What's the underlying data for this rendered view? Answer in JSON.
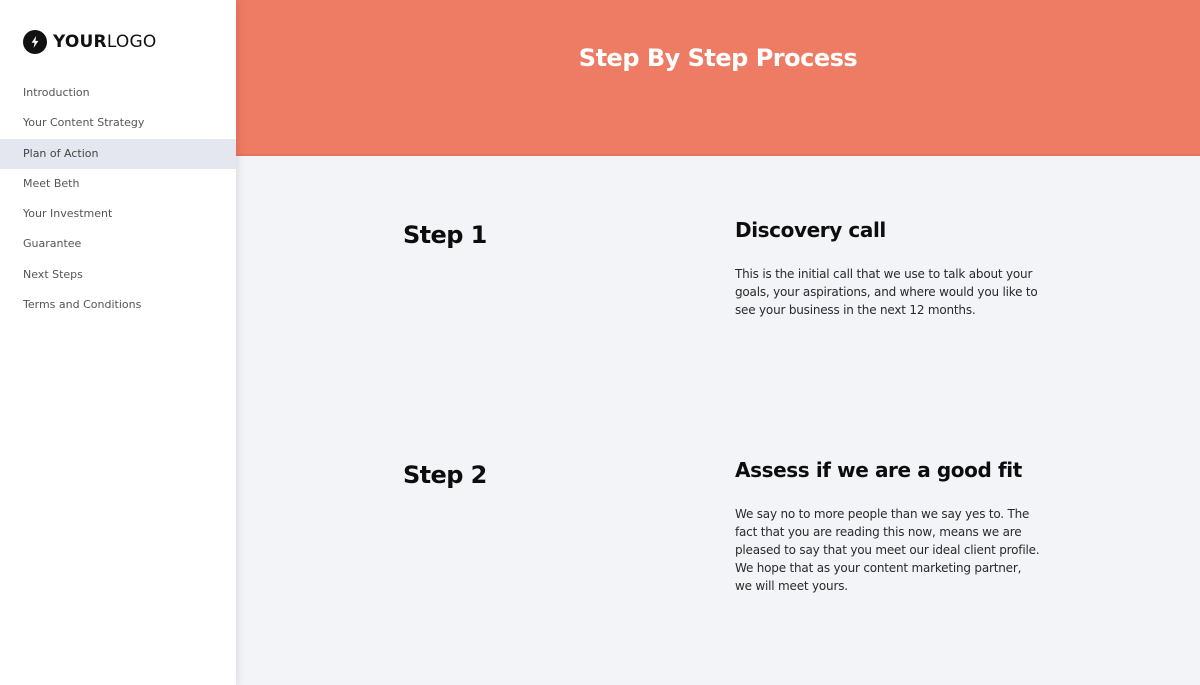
{
  "brand": {
    "logo_bold": "YOUR",
    "logo_light": "LOGO",
    "logo_icon": "lightning-bolt-icon"
  },
  "sidebar": {
    "active_index": 2,
    "items": [
      {
        "label": "Introduction"
      },
      {
        "label": "Your Content Strategy"
      },
      {
        "label": "Plan of Action"
      },
      {
        "label": "Meet Beth"
      },
      {
        "label": "Your Investment"
      },
      {
        "label": "Guarantee"
      },
      {
        "label": "Next Steps"
      },
      {
        "label": "Terms and Conditions"
      }
    ]
  },
  "banner": {
    "title": "Step By Step Process",
    "color": "#ee7b64"
  },
  "steps": [
    {
      "label": "Step 1",
      "heading": "Discovery call",
      "body": "This is the initial call that we use to talk about your goals, your aspirations, and where would you like to see your business in the next 12 months."
    },
    {
      "label": "Step 2",
      "heading": "Assess if we are a good fit",
      "body": "We say no to more people than we say yes to. The fact that you are reading this now, means we are pleased to say that you meet our ideal client profile. We hope that as your content marketing partner, we will meet yours."
    }
  ],
  "colors": {
    "accent": "#ee7b64",
    "content_bg": "#f3f4f8",
    "sidebar_active_bg": "#e4e7ef"
  }
}
